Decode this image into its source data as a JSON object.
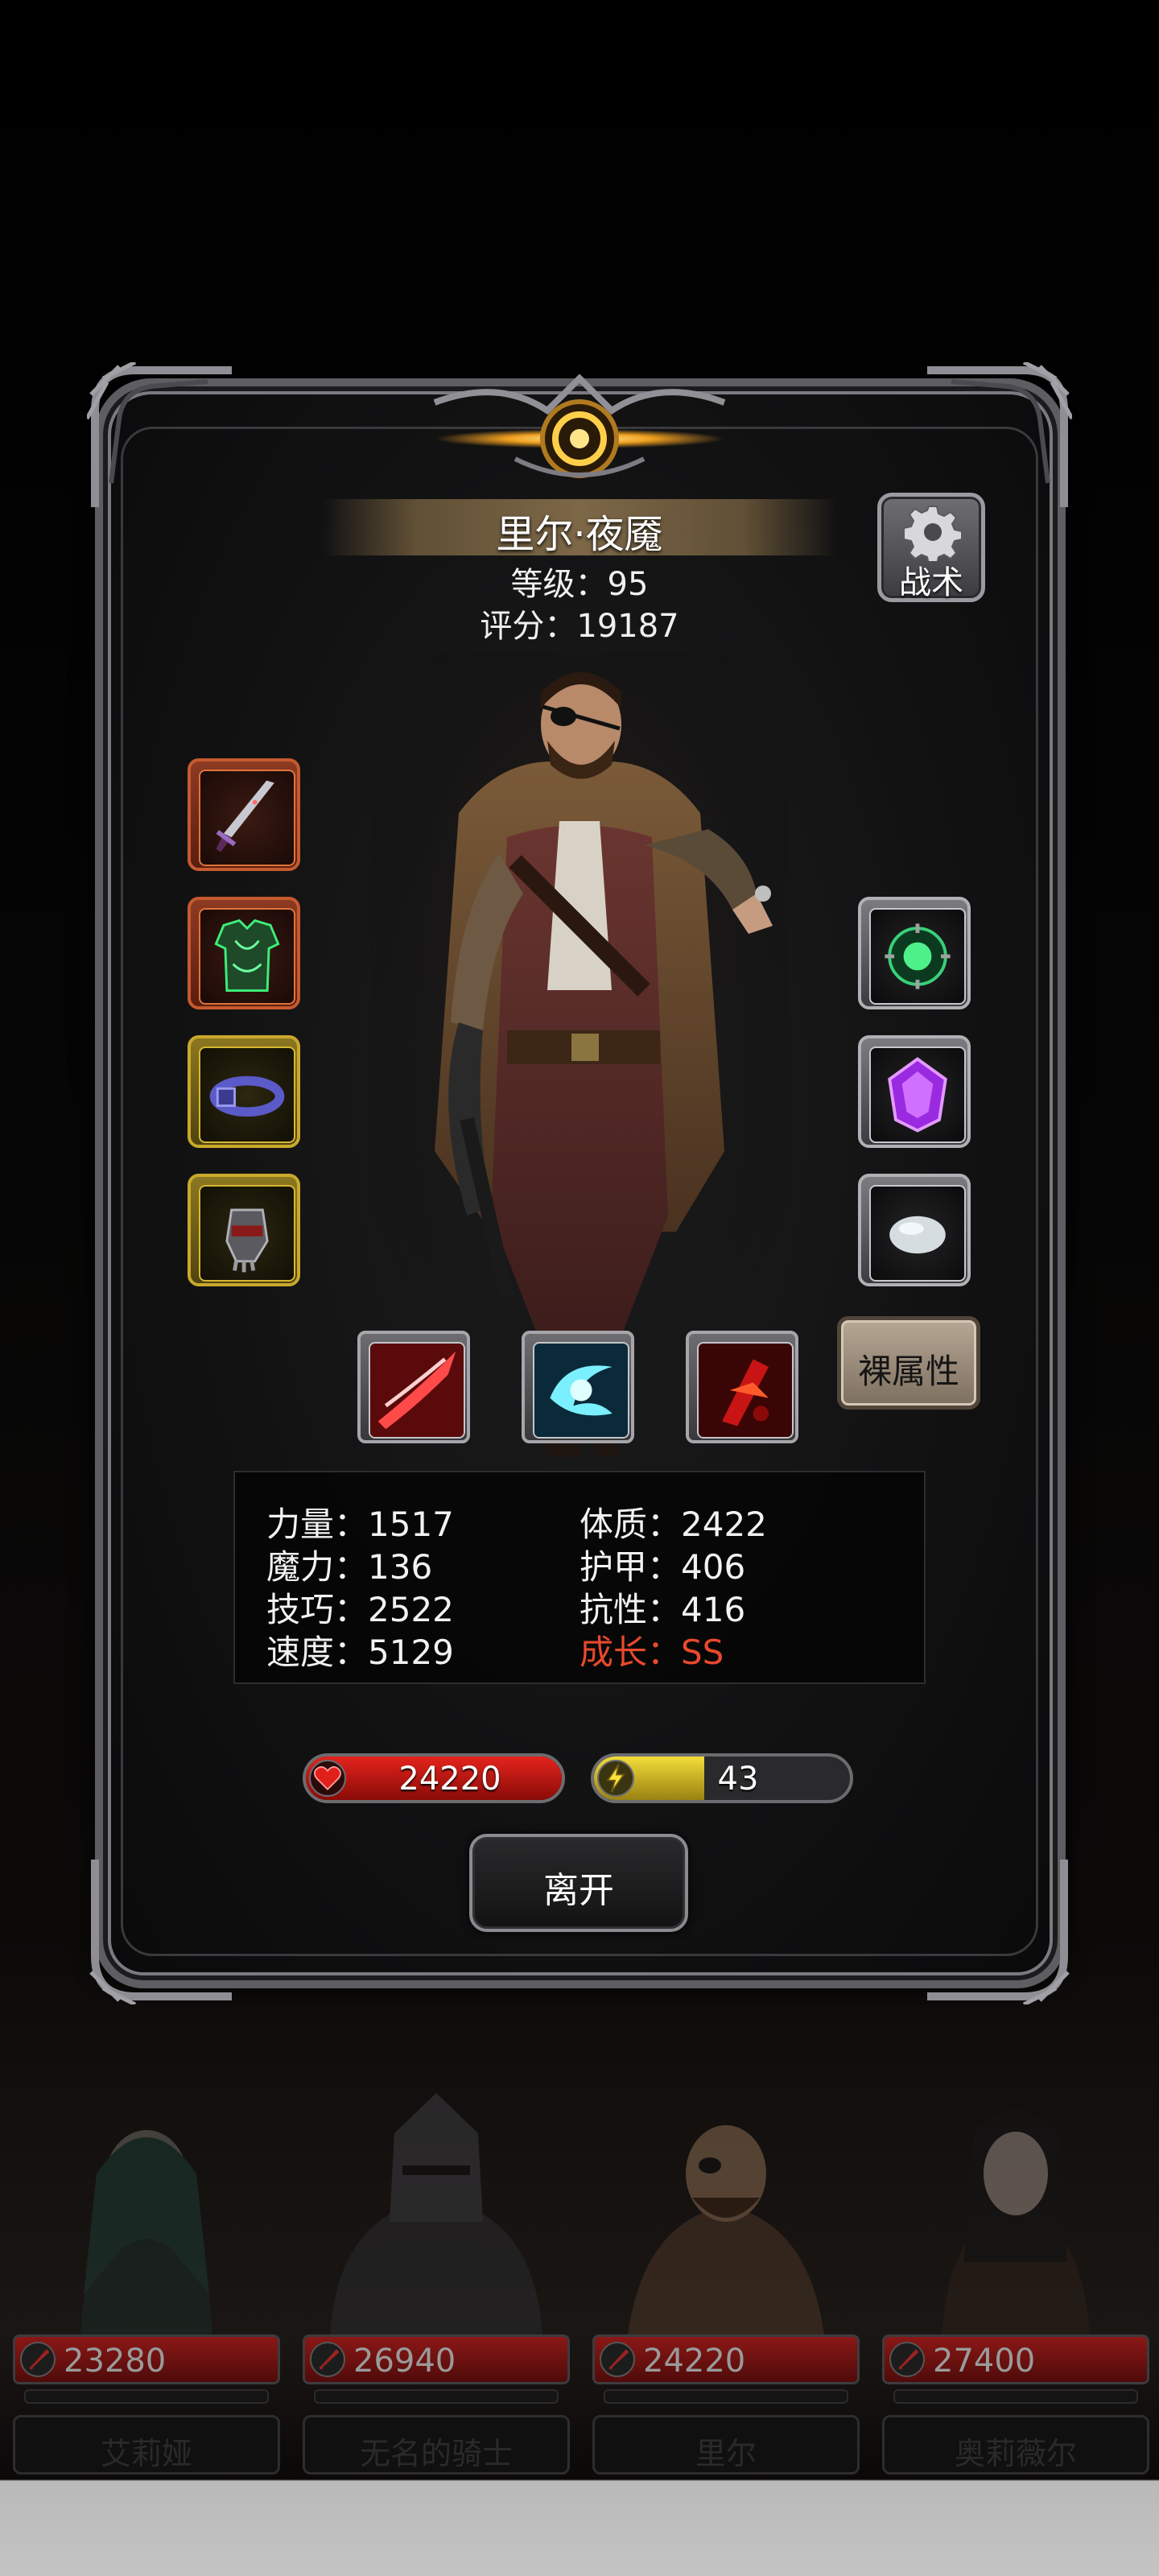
{
  "hero": {
    "name": "里尔·夜魇",
    "level_text": "等级：95",
    "score_text": "评分：19187"
  },
  "buttons": {
    "tactics": "战术",
    "bare_attributes": "裸属性",
    "leave": "离开"
  },
  "equipment": {
    "left": [
      {
        "name": "dagger-icon",
        "rarity": "red"
      },
      {
        "name": "armor-icon",
        "rarity": "red"
      },
      {
        "name": "belt-icon",
        "rarity": "gold"
      },
      {
        "name": "gauntlet-icon",
        "rarity": "gold"
      }
    ],
    "right": [
      {
        "name": "emerald-amulet-icon",
        "rarity": "silver"
      },
      {
        "name": "purple-gem-icon",
        "rarity": "silver"
      },
      {
        "name": "white-stone-icon",
        "rarity": "silver"
      }
    ]
  },
  "skills": [
    {
      "name": "crimson-slash-icon"
    },
    {
      "name": "cyan-whirl-icon"
    },
    {
      "name": "blood-strike-icon"
    }
  ],
  "stats": {
    "strength": "力量：1517",
    "magic": "魔力：136",
    "skill": "技巧：2522",
    "speed": "速度：5129",
    "constitution": "体质：2422",
    "armor": "护甲：406",
    "resistance": "抗性：416",
    "growth": "成长：SS"
  },
  "bars": {
    "hp": "24220",
    "hp_fill": 1.0,
    "energy": "43",
    "energy_fill": 0.43
  },
  "team": [
    {
      "hp": "23280",
      "name": "艾莉娅",
      "hp_fill": 1.0
    },
    {
      "hp": "26940",
      "name": "无名的骑士",
      "hp_fill": 1.0
    },
    {
      "hp": "24220",
      "name": "里尔",
      "hp_fill": 1.0
    },
    {
      "hp": "27400",
      "name": "奥莉薇尔",
      "hp_fill": 1.0
    }
  ],
  "colors": {
    "hp_red": "#e4231c",
    "energy_yellow": "#f2dd3a",
    "growth_red": "#e8492c",
    "banner_gold": "#826c4a"
  }
}
